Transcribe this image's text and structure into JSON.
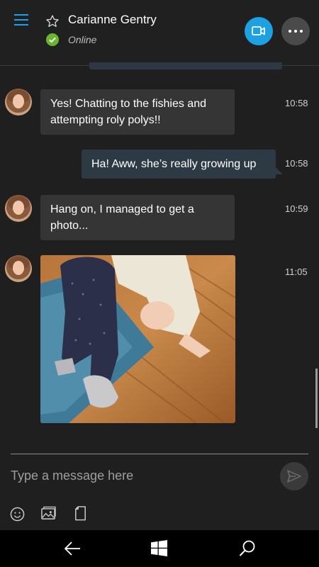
{
  "header": {
    "contact_name": "Carianne Gentry",
    "status": "Online",
    "accent_color": "#1da1e2",
    "status_color": "#6ab42f",
    "icons": [
      "hamburger-menu-icon",
      "star-icon",
      "online-check-icon",
      "video-call-icon",
      "more-options-icon"
    ]
  },
  "messages": [
    {
      "direction": "incoming",
      "text": "Yes! Chatting to the fishies and attempting roly polys!!",
      "time": "10:58"
    },
    {
      "direction": "outgoing",
      "text": "Ha! Aww, she’s really growing up",
      "time": "10:58"
    },
    {
      "direction": "incoming",
      "text": "Hang on, I managed to get a photo...",
      "time": "10:59"
    },
    {
      "direction": "incoming",
      "type": "photo",
      "time": "11:05"
    }
  ],
  "composer": {
    "placeholder": "Type a message here",
    "icons": [
      "emoji-icon",
      "photo-gallery-icon",
      "file-icon",
      "send-icon"
    ]
  },
  "taskbar": {
    "icons": [
      "back-arrow-icon",
      "windows-start-icon",
      "search-icon"
    ]
  }
}
